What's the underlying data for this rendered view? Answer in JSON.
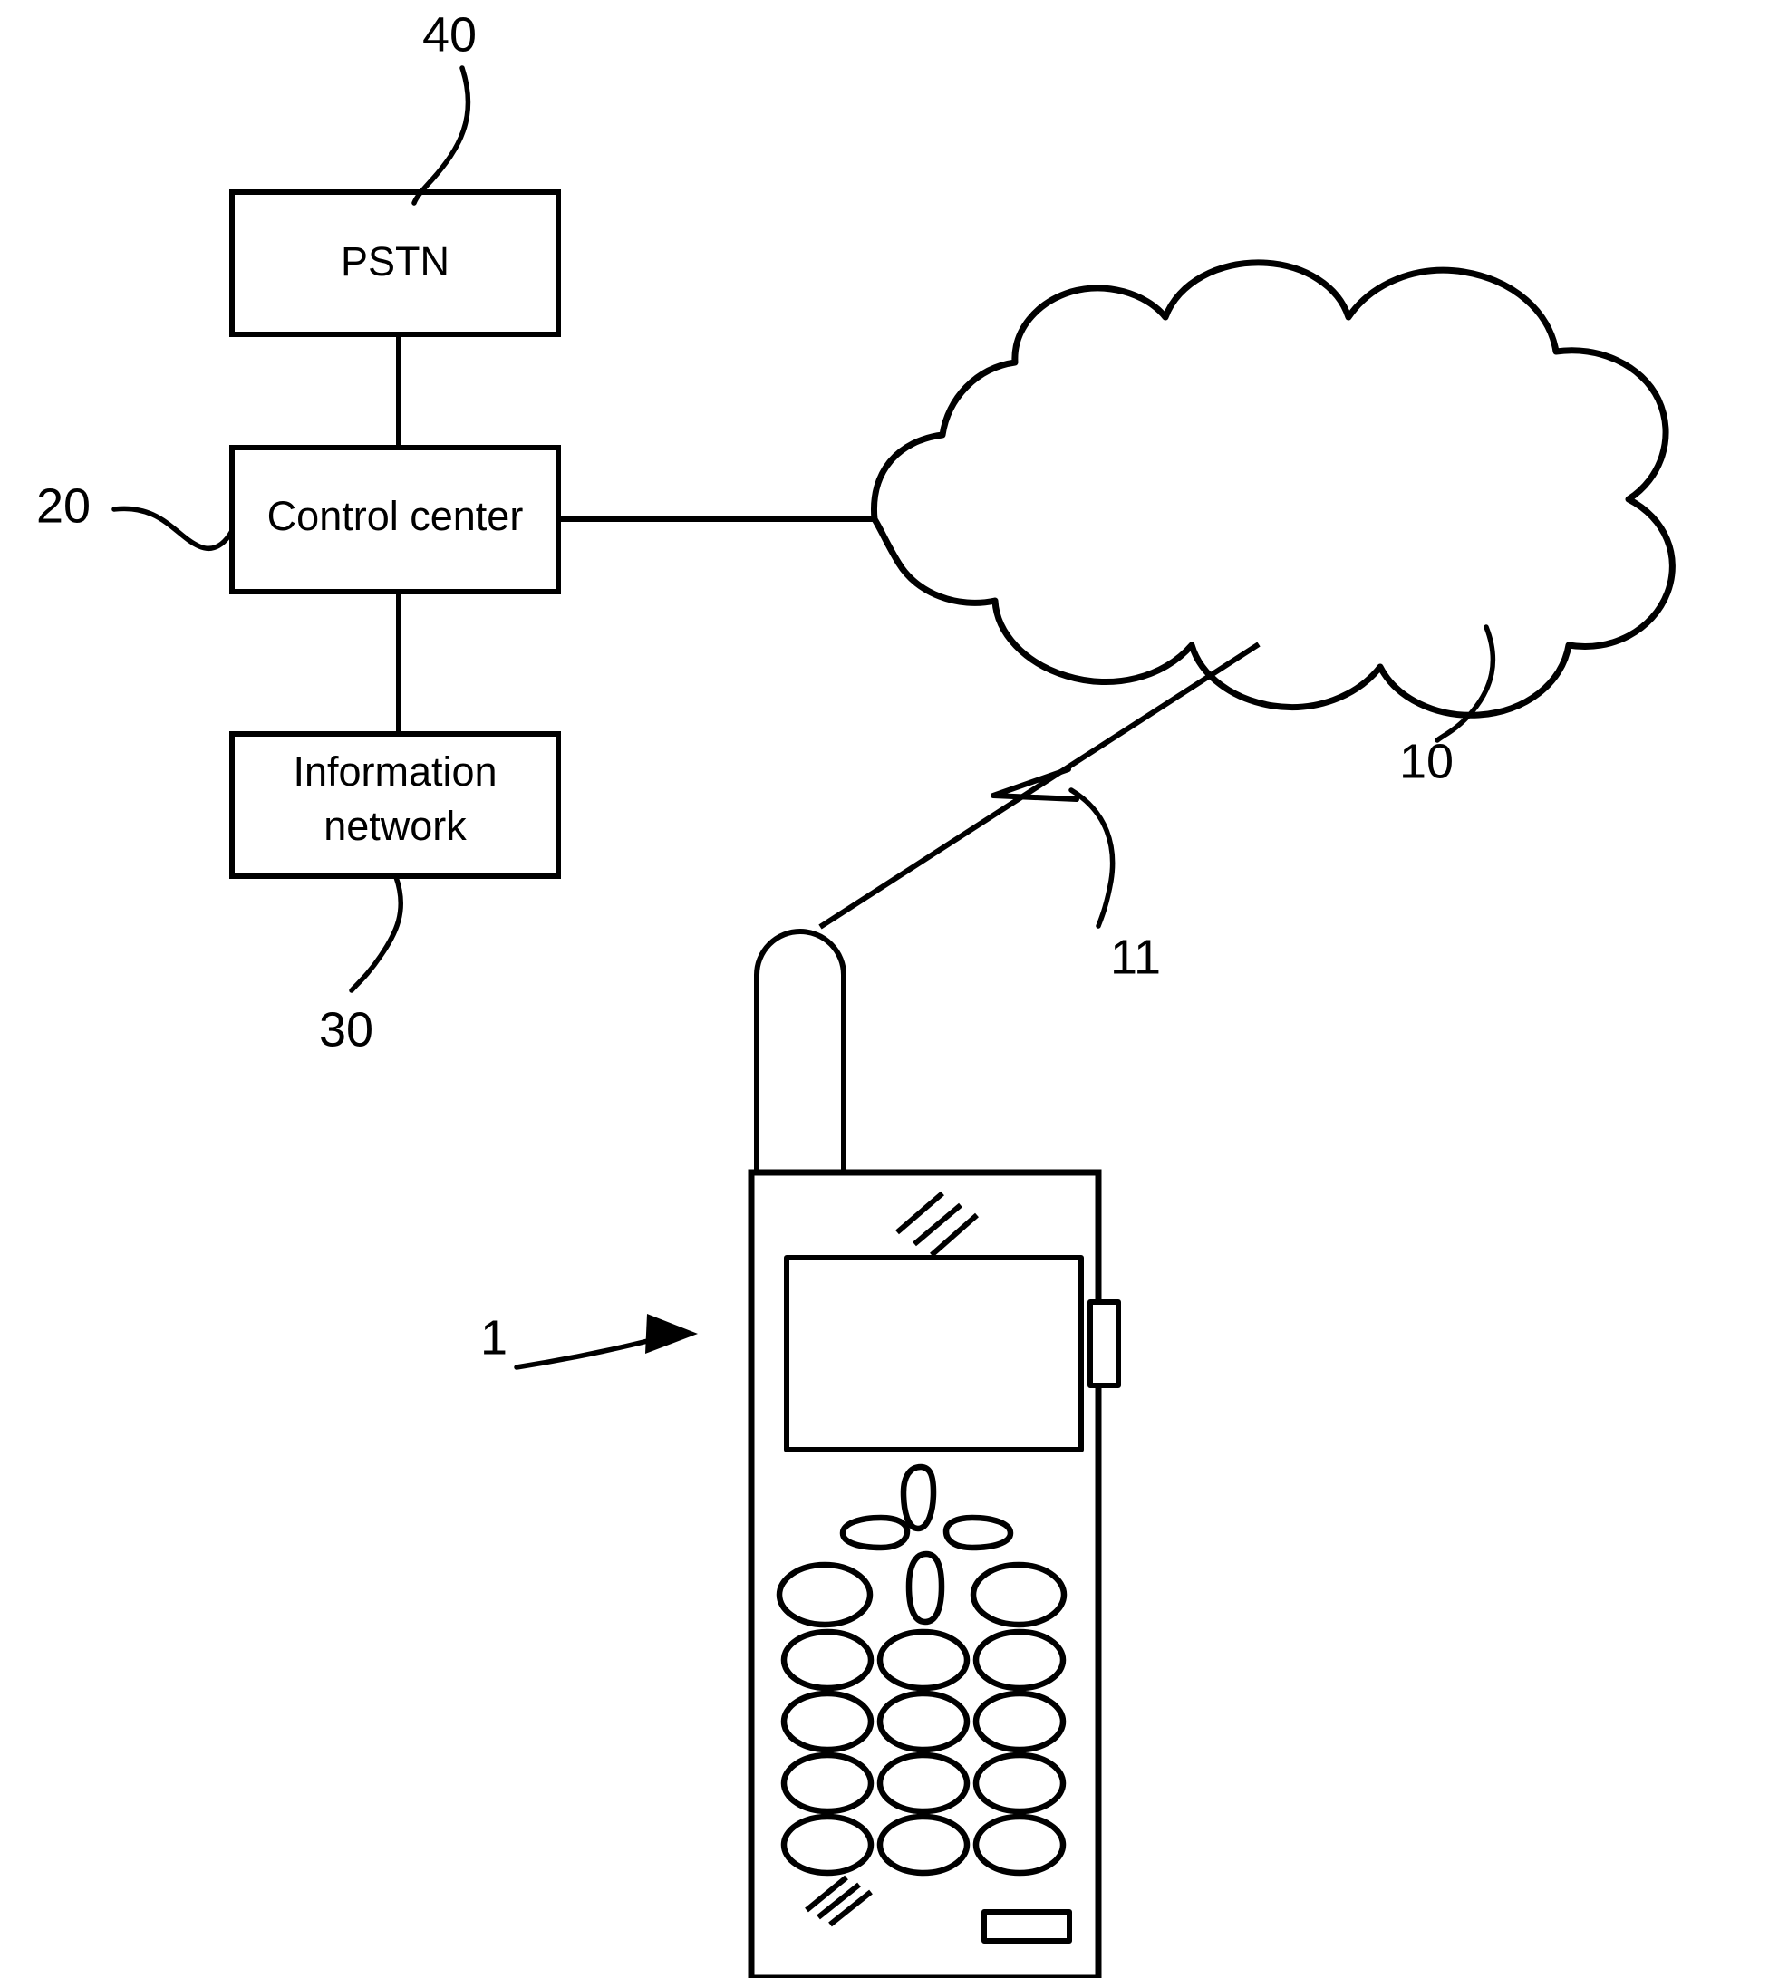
{
  "figure": {
    "title": "Mobile communication system block diagram",
    "background_color": "#ffffff",
    "line_color": "#000000"
  },
  "blocks": [
    {
      "id": "pstn",
      "label": "PSTN",
      "reference_numeral": "40"
    },
    {
      "id": "control-center",
      "label": "Control center",
      "reference_numeral": "20"
    },
    {
      "id": "information-network",
      "label_line1": "Information",
      "label_line2": "network",
      "reference_numeral": "30"
    }
  ],
  "cloud": {
    "id": "network-cloud",
    "reference_numeral": "10",
    "label": ""
  },
  "radio_link": {
    "id": "air-interface",
    "reference_numeral": "11"
  },
  "mobile_terminal": {
    "id": "mobile-phone",
    "reference_numeral": "1",
    "parts": {
      "antenna": "antenna",
      "display": "display-screen",
      "side_button": "side-button",
      "navigation_key": "navigation-key",
      "keypad_rows": 5,
      "keypad_cols": 3,
      "earpiece": "earpiece-grille",
      "microphone": "microphone-grille",
      "bottom_connector": "bottom-connector"
    }
  },
  "reference_numerals": {
    "pstn": "40",
    "control_center": "20",
    "information_network": "30",
    "cloud": "10",
    "radio_link": "11",
    "mobile_phone": "1"
  }
}
